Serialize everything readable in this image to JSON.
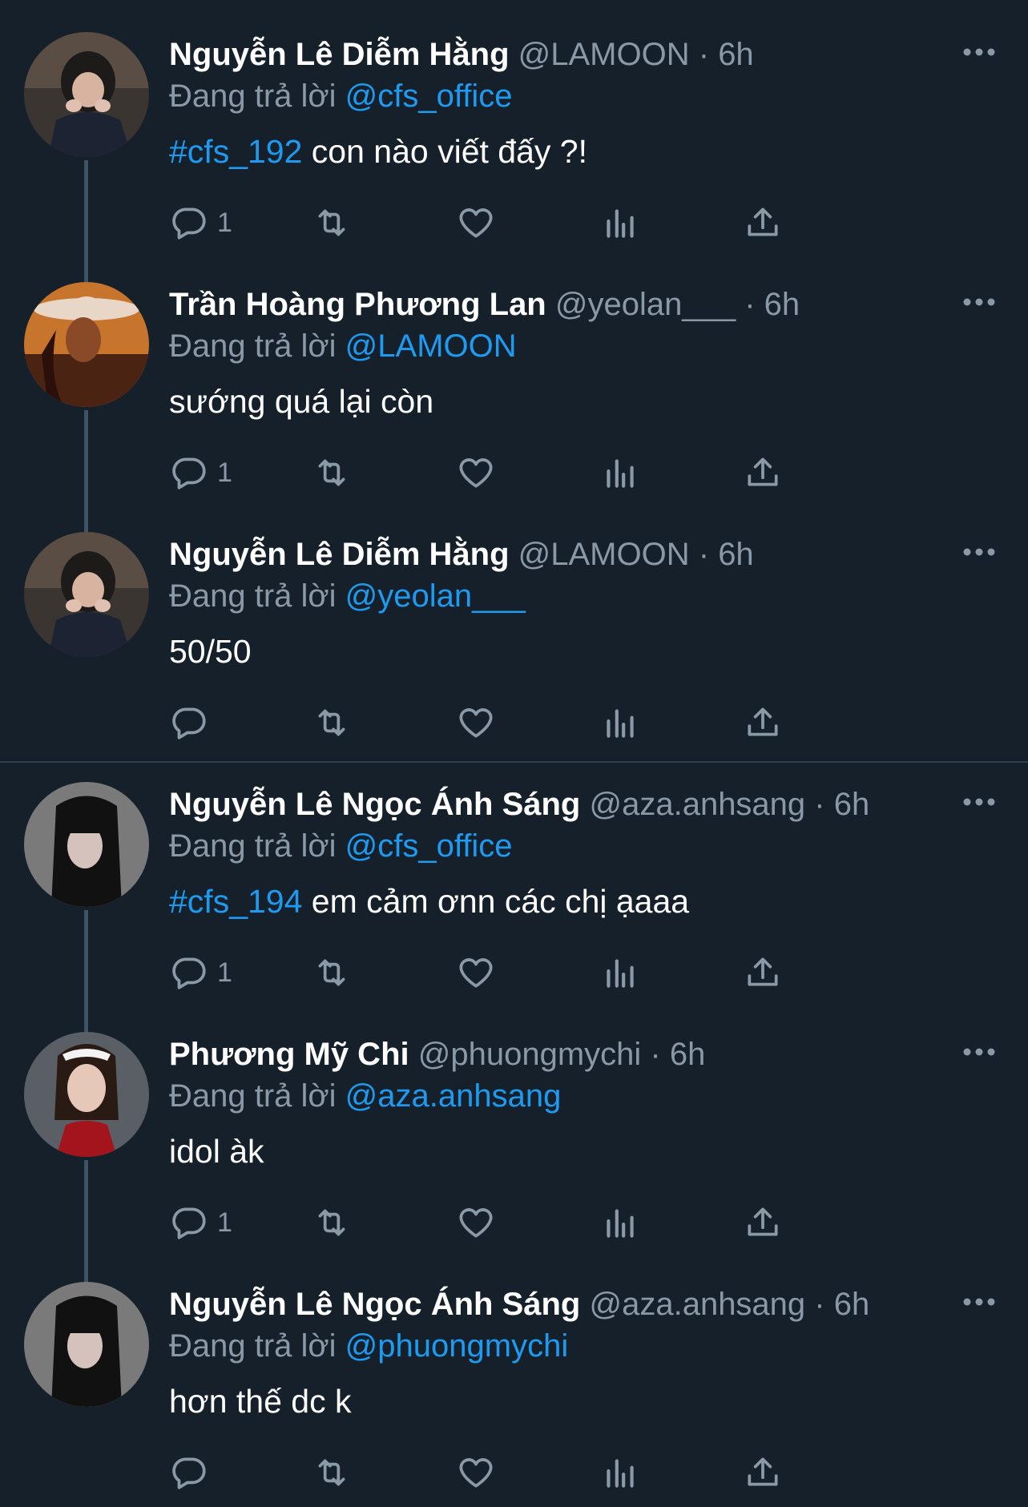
{
  "colors": {
    "background": "#15202b",
    "accent": "#1d9bf0",
    "secondary_text": "#8b98a5",
    "thread_line": "#3d5466"
  },
  "labels": {
    "replying_prefix": "Đang trả lời"
  },
  "tweets": [
    {
      "name": "Nguyễn Lê Diễm Hằng",
      "handle": "@LAMOON",
      "sep": "·",
      "time": "6h",
      "replying_to": "@cfs_office",
      "hashtag": "#cfs_192",
      "text": " con nào viết đấy ?!",
      "reply_count": "1",
      "avatar": "dark-haired-girl-avatar"
    },
    {
      "name": "Trần Hoàng Phương Lan",
      "handle": "@yeolan___",
      "sep": "·",
      "time": "6h",
      "replying_to": "@LAMOON",
      "hashtag": "",
      "text": "sướng quá lại còn",
      "reply_count": "1",
      "avatar": "cowboy-hat-avatar"
    },
    {
      "name": "Nguyễn Lê Diễm Hằng",
      "handle": "@LAMOON",
      "sep": "·",
      "time": "6h",
      "replying_to": "@yeolan___",
      "hashtag": "",
      "text": "50/50",
      "reply_count": "",
      "avatar": "dark-haired-girl-avatar"
    },
    {
      "name": "Nguyễn Lê Ngọc Ánh Sáng",
      "handle": "@aza.anhsang",
      "sep": "·",
      "time": "6h",
      "replying_to": "@cfs_office",
      "hashtag": "#cfs_194",
      "text": " em cảm ơnn các chị ạaaa",
      "reply_count": "1",
      "avatar": "long-hair-bangs-avatar"
    },
    {
      "name": "Phương Mỹ Chi",
      "handle": "@phuongmychi",
      "sep": "·",
      "time": "6h",
      "replying_to": "@aza.anhsang",
      "hashtag": "",
      "text": "idol àk",
      "reply_count": "1",
      "avatar": "red-top-girl-avatar"
    },
    {
      "name": "Nguyễn Lê Ngọc Ánh Sáng",
      "handle": "@aza.anhsang",
      "sep": "·",
      "time": "6h",
      "replying_to": "@phuongmychi",
      "hashtag": "",
      "text": "hơn thế dc k",
      "reply_count": "",
      "avatar": "long-hair-bangs-avatar"
    }
  ]
}
